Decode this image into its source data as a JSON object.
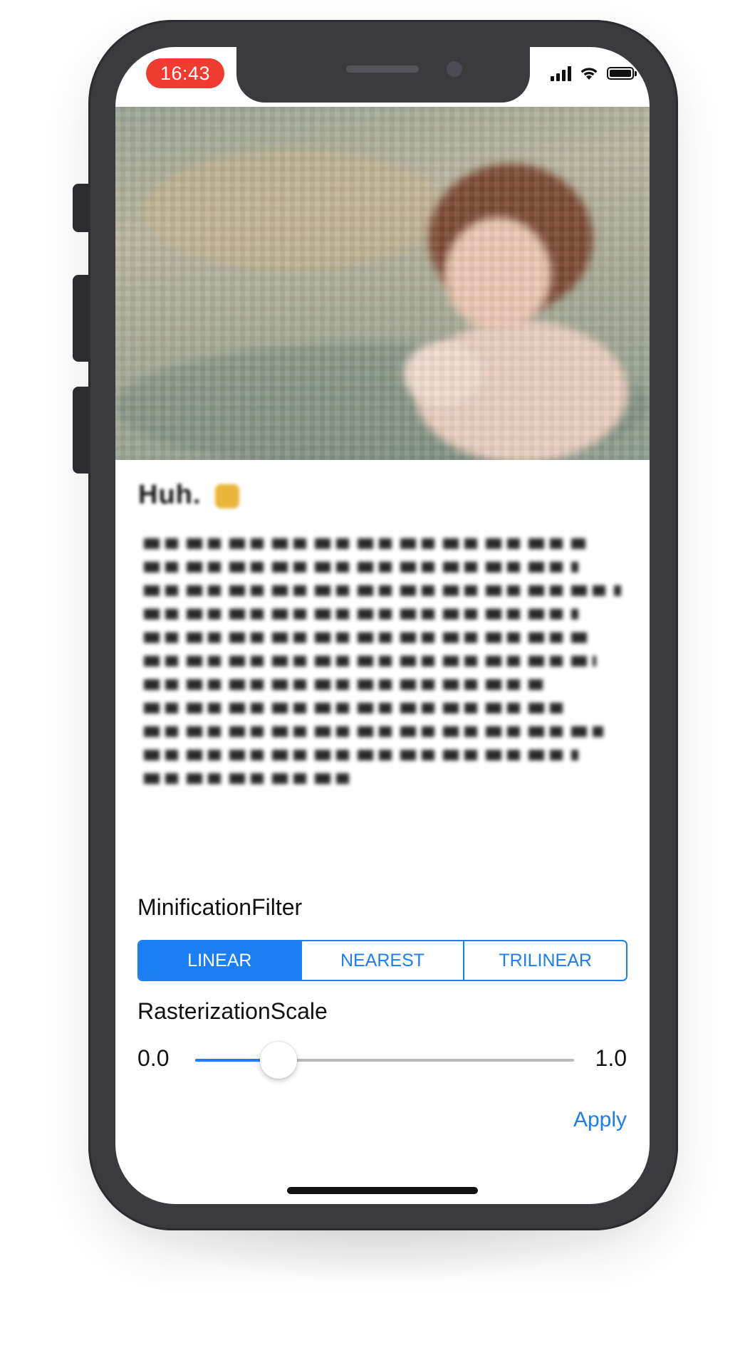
{
  "status_bar": {
    "time": "16:43",
    "time_pill_color": "#f03b30"
  },
  "hero": {
    "image_description_icon": "photo-icon"
  },
  "content": {
    "title": "Huh.",
    "title_icon": "emoji-icon"
  },
  "controls": {
    "minification_label": "MinificationFilter",
    "minification_options": [
      "LINEAR",
      "NEAREST",
      "TRILINEAR"
    ],
    "minification_selected": "LINEAR",
    "rasterization_label": "RasterizationScale",
    "slider_min_label": "0.0",
    "slider_max_label": "1.0",
    "slider_value": 0.22,
    "apply_label": "Apply"
  },
  "colors": {
    "accent": "#1c7ef5",
    "phone_frame": "#3b3a3f"
  }
}
